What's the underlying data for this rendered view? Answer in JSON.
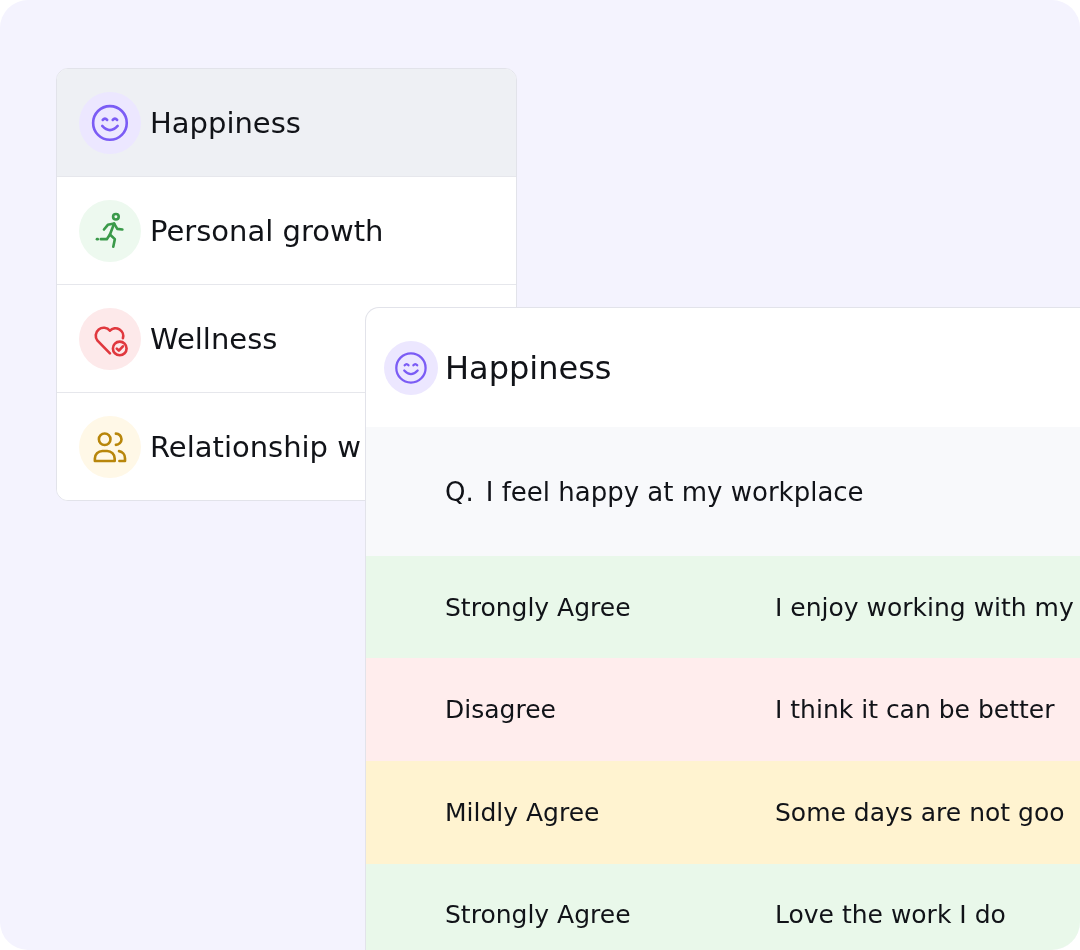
{
  "categories": [
    {
      "kind": "smile",
      "label": "Happiness",
      "color": "#7b5cf5",
      "selected": true
    },
    {
      "kind": "runner",
      "label": "Personal growth",
      "color": "#3a9a4a",
      "selected": false
    },
    {
      "kind": "heart",
      "label": "Wellness",
      "color": "#e0383e",
      "selected": false
    },
    {
      "kind": "people",
      "label": "Relationship w",
      "color": "#b8860b",
      "selected": false
    }
  ],
  "detail": {
    "kind": "smile",
    "color": "#7b5cf5",
    "title": "Happiness",
    "question": {
      "prefix": "Q.",
      "text": "I feel happy at my workplace"
    },
    "responses": [
      {
        "answer": "Strongly Agree",
        "comment": "I enjoy working with my",
        "color": "#e9f8ea"
      },
      {
        "answer": "Disagree",
        "comment": "I think it can be better",
        "color": "#ffeded"
      },
      {
        "answer": "Mildly Agree",
        "comment": "Some days are not goo",
        "color": "#fff3d0"
      },
      {
        "answer": "Strongly Agree",
        "comment": "Love the work I do",
        "color": "#e9f8ea"
      }
    ]
  }
}
